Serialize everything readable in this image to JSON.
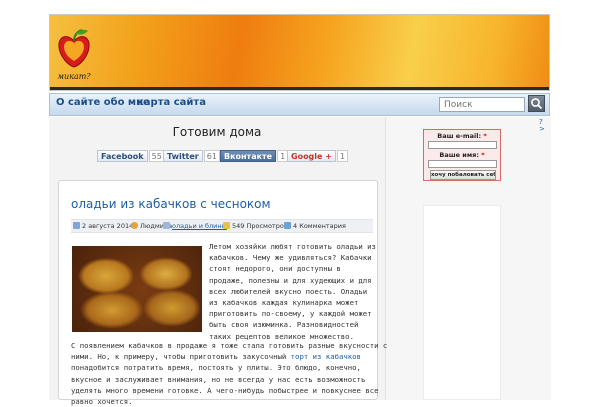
{
  "header": {
    "logo_text": "микат?"
  },
  "nav": {
    "items": [
      "О сайте обо мне",
      "карта сайта"
    ],
    "search_placeholder": "Поиск"
  },
  "page": {
    "title": "Готовим дома"
  },
  "share": [
    {
      "label": "Facebook",
      "count": "55"
    },
    {
      "label": "Twitter",
      "count": "61"
    },
    {
      "label": "Вконтакте",
      "count": "1"
    },
    {
      "label": "Google +",
      "count": "1"
    }
  ],
  "post": {
    "title": "оладьи из кабачков с чесноком",
    "meta": {
      "date": "2 августа 2014",
      "author": "Людмила",
      "category": "оладьи и блины",
      "views": "549 Просмотров",
      "comments": "4 Комментария"
    },
    "intro_lines": [
      "Летом хозяйки любят готовить оладьи из",
      "кабачков. Чему же удивляться? Кабачки",
      "стоят недорого, они доступны в",
      "продаже, полезны и для худеющих и для",
      "всех любителей вкусно поесть.  Оладьи",
      "из кабачков каждая кулинарка может",
      "приготовить по-своему, у каждой может",
      "быть своя изюминка. Разновидностей",
      "таких рецептов великое множество."
    ],
    "body_line1": "С появлением кабачков в продаже я тоже стала готовить разные вкусности с",
    "body_line2_before": "ними. Но, к примеру, чтобы приготовить закусочный ",
    "body_link": "торт из кабачков",
    "body_lines_rest": [
      "понадобится потратить время, постоять у плиты. Это блюдо, конечно,",
      "вкусное и заслуживает внимания, но не всегда у нас есть возможность",
      "уделять много времени готовке. А  чего-нибудь побыстрее и повкуснее все",
      "равно хочется."
    ]
  },
  "sidebar": {
    "email_label": "Ваш e-mail:",
    "name_label": "Ваше имя:",
    "required_mark": "*",
    "subscribe_button": "хочу побаловать себя!",
    "qmark": "?"
  },
  "colors": {
    "link": "#1d5fa3",
    "nav_text": "#1a4f8a",
    "header_orange": "#ef7d0f",
    "required_red": "#cc0000"
  }
}
